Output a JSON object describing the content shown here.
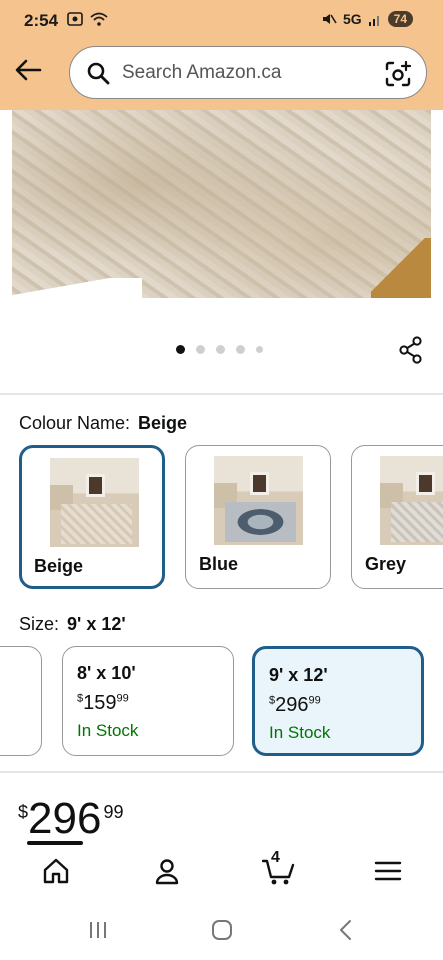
{
  "status_bar": {
    "time": "2:54",
    "network": "5G",
    "battery": "74"
  },
  "search": {
    "placeholder": "Search Amazon.ca"
  },
  "carousel": {
    "dot_count": 5,
    "active_index": 0
  },
  "colour": {
    "label": "Colour Name:",
    "selected": "Beige",
    "options": [
      {
        "label": "Beige",
        "selected": true
      },
      {
        "label": "Blue",
        "selected": false
      },
      {
        "label": "Grey",
        "selected": false
      }
    ]
  },
  "size": {
    "label": "Size:",
    "selected": "9' x 12'",
    "options": [
      {
        "title": "8' x 10'",
        "price_symbol": "$",
        "price_whole": "159",
        "price_fraction": "99",
        "stock": "In Stock",
        "selected": false
      },
      {
        "title": "9' x 12'",
        "price_symbol": "$",
        "price_whole": "296",
        "price_fraction": "99",
        "stock": "In Stock",
        "selected": true
      }
    ]
  },
  "price": {
    "symbol": "$",
    "whole": "296",
    "fraction": "99"
  },
  "bottom_nav": {
    "cart_count": "4",
    "items": [
      "home-icon",
      "account-icon",
      "cart-icon",
      "menu-icon"
    ]
  }
}
